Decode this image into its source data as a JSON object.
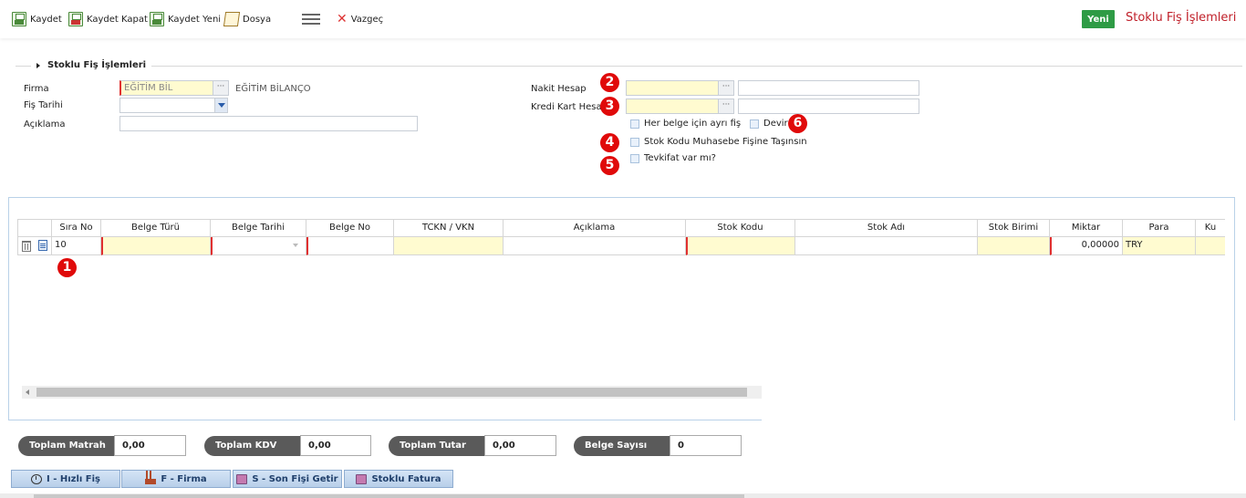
{
  "toolbar": {
    "kaydet": "Kaydet",
    "kaydet_kapat": "Kaydet Kapat",
    "kaydet_yeni": "Kaydet Yeni",
    "dosya": "Dosya",
    "vazgec": "Vazgeç",
    "yeni": "Yeni",
    "title": "Stoklu Fiş İşlemleri"
  },
  "section": {
    "title": "Stoklu Fiş İşlemleri"
  },
  "form": {
    "firma_label": "Firma",
    "firma_value": "EĞİTİM BİL",
    "firma_desc": "EĞİTİM BİLANÇO",
    "fis_tarihi_label": "Fiş Tarihi",
    "fis_tarihi_value": "",
    "aciklama_label": "Açıklama",
    "aciklama_value": "",
    "nakit_label": "Nakit Hesap",
    "nakit_value": "",
    "nakit_desc": "",
    "kredi_label": "Kredi Kart Hesap",
    "kredi_value": "",
    "kredi_desc": "",
    "dots": "···"
  },
  "checkboxes": {
    "her_belge": "Her belge için ayrı fiş",
    "devir": "Devir",
    "stok_kodu": "Stok Kodu Muhasebe Fişine Taşınsın",
    "tevkifat": "Tevkifat var mı?"
  },
  "badges": {
    "b1": "1",
    "b2": "2",
    "b3": "3",
    "b4": "4",
    "b5": "5",
    "b6": "6"
  },
  "grid": {
    "headers": [
      "Sıra No",
      "Belge Türü",
      "Belge Tarihi",
      "Belge No",
      "TCKN / VKN",
      "Açıklama",
      "Stok Kodu",
      "Stok Adı",
      "Stok Birimi",
      "Miktar",
      "Para",
      "Ku"
    ],
    "row": {
      "sira_no": "10",
      "belge_turu": "",
      "belge_tarihi": "",
      "belge_no": "",
      "tckn": "",
      "aciklama": "",
      "stok_kodu": "",
      "stok_adi": "",
      "stok_birimi": "",
      "miktar": "0,00000",
      "para": "TRY",
      "ku": ""
    }
  },
  "totals": {
    "matrah_label": "Toplam Matrah",
    "matrah_value": "0,00",
    "kdv_label": "Toplam KDV",
    "kdv_value": "0,00",
    "tutar_label": "Toplam Tutar",
    "tutar_value": "0,00",
    "belge_label": "Belge Sayısı",
    "belge_value": "0"
  },
  "footer": {
    "hizli": "I - Hızlı Fiş",
    "firma": "F - Firma",
    "son_fis": "S - Son Fişi Getir",
    "stoklu_fatura": "Stoklu Fatura"
  },
  "colors": {
    "accent_red": "#c0202a",
    "yeni_green": "#2e9b45",
    "badge_red": "#e00a0a",
    "required_yellow": "#fffbd0"
  }
}
